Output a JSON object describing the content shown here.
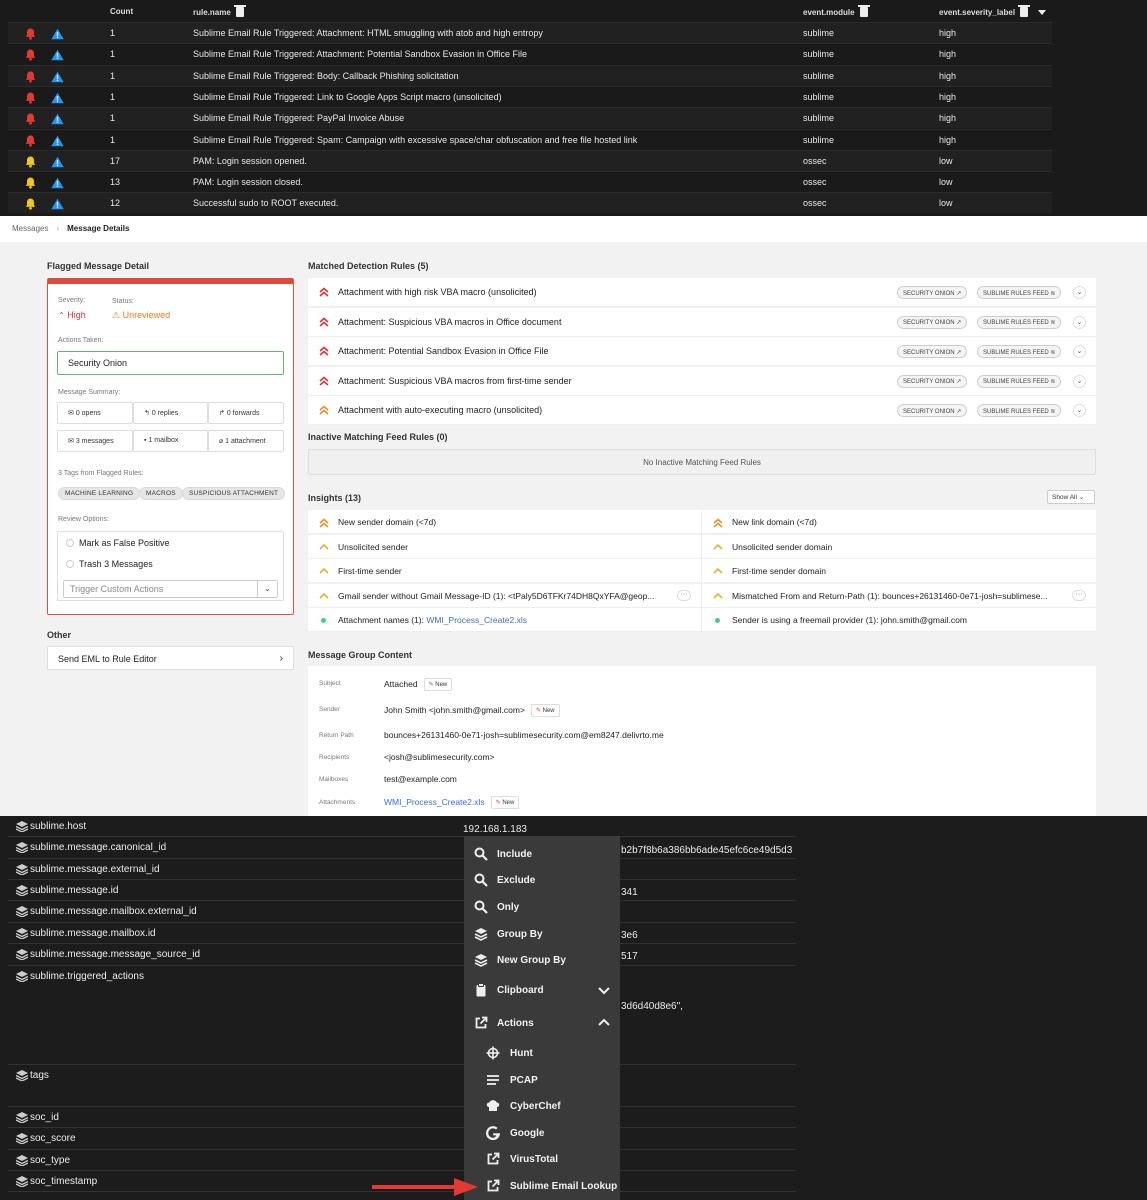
{
  "alerts_table": {
    "columns": {
      "count": "Count",
      "rule_name": "rule.name",
      "event_module": "event.module",
      "severity": "event.severity_label"
    },
    "rows": [
      {
        "level": "high",
        "count": "1",
        "rule": "Sublime Email Rule Triggered: Attachment: HTML smuggling with atob and high entropy",
        "module": "sublime",
        "severity": "high"
      },
      {
        "level": "high",
        "count": "1",
        "rule": "Sublime Email Rule Triggered: Attachment: Potential Sandbox Evasion in Office File",
        "module": "sublime",
        "severity": "high"
      },
      {
        "level": "high",
        "count": "1",
        "rule": "Sublime Email Rule Triggered: Body: Callback Phishing solicitation",
        "module": "sublime",
        "severity": "high"
      },
      {
        "level": "high",
        "count": "1",
        "rule": "Sublime Email Rule Triggered: Link to Google Apps Script macro (unsolicited)",
        "module": "sublime",
        "severity": "high"
      },
      {
        "level": "high",
        "count": "1",
        "rule": "Sublime Email Rule Triggered: PayPal Invoice Abuse",
        "module": "sublime",
        "severity": "high"
      },
      {
        "level": "high",
        "count": "1",
        "rule": "Sublime Email Rule Triggered: Spam: Campaign with excessive space/char obfuscation and free file hosted link",
        "module": "sublime",
        "severity": "high"
      },
      {
        "level": "low",
        "count": "17",
        "rule": "PAM: Login session opened.",
        "module": "ossec",
        "severity": "low"
      },
      {
        "level": "low",
        "count": "13",
        "rule": "PAM: Login session closed.",
        "module": "ossec",
        "severity": "low"
      },
      {
        "level": "low",
        "count": "12",
        "rule": "Successful sudo to ROOT executed.",
        "module": "ossec",
        "severity": "low"
      }
    ]
  },
  "breadcrumb": {
    "parent": "Messages",
    "current": "Message Details"
  },
  "flagged": {
    "title": "Flagged Message Detail",
    "severity_label": "Severity:",
    "severity_value": "High",
    "status_label": "Status:",
    "status_value": "Unreviewed",
    "actions_label": "Actions Taken:",
    "actions_value": "Security Onion",
    "summary_label": "Message Summary:",
    "summary": [
      "0 opens",
      "0 replies",
      "0 forwards",
      "3 messages",
      "1 mailbox",
      "1 attachment"
    ],
    "tags_label": "3 Tags from Flagged Rules:",
    "tags": [
      "MACHINE LEARNING",
      "MACROS",
      "SUSPICIOUS ATTACHMENT"
    ],
    "review_label": "Review Options:",
    "review_options": [
      "Mark as False Positive",
      "Trash 3 Messages"
    ],
    "trigger_placeholder": "Trigger Custom Actions"
  },
  "other": {
    "title": "Other",
    "button": "Send EML to Rule Editor"
  },
  "matched": {
    "title": "Matched Detection Rules (5)",
    "tag1": "SECURITY ONION",
    "tag2": "SUBLIME RULES FEED",
    "rules": [
      {
        "name": "Attachment with high risk VBA macro (unsolicited)",
        "level": "high"
      },
      {
        "name": "Attachment: Suspicious VBA macros in Office document",
        "level": "high"
      },
      {
        "name": "Attachment: Potential Sandbox Evasion in Office File",
        "level": "high"
      },
      {
        "name": "Attachment: Suspicious VBA macros from first-time sender",
        "level": "high"
      },
      {
        "name": "Attachment with auto-executing macro (unsolicited)",
        "level": "medium"
      }
    ]
  },
  "inactive": {
    "title": "Inactive Matching Feed Rules (0)",
    "empty": "No Inactive Matching Feed Rules"
  },
  "insights": {
    "title": "Insights (13)",
    "show_all": "Show All",
    "left": [
      {
        "text": "New sender domain (<7d)",
        "icon": "double-chevron"
      },
      {
        "text": "Unsolicited sender",
        "icon": "chevron"
      },
      {
        "text": "First-time sender",
        "icon": "chevron"
      },
      {
        "text": "Gmail sender without Gmail Message-ID (1): <tPaly5D6TFKr74DH8QxYFA@geop...",
        "icon": "chevron",
        "more": true
      },
      {
        "text": "Attachment names (1): ",
        "link": "WMI_Process_Create2.xls",
        "icon": "dot"
      }
    ],
    "right": [
      {
        "text": "New link domain (<7d)",
        "icon": "double-chevron"
      },
      {
        "text": "Unsolicited sender domain",
        "icon": "chevron"
      },
      {
        "text": "First-time sender domain",
        "icon": "chevron"
      },
      {
        "text": "Mismatched From and Return-Path (1): bounces+26131460-0e71-josh=sublimese...",
        "icon": "chevron",
        "more": true
      },
      {
        "text": "Sender is using a freemail provider (1): john.smith@gmail.com",
        "icon": "dot"
      }
    ]
  },
  "group_content": {
    "title": "Message Group Content",
    "new_label": "New",
    "subject_label": "Subject",
    "subject": "Attached",
    "sender_label": "Sender",
    "sender": "John Smith <john.smith@gmail.com>",
    "return_label": "Return Path",
    "return_path": "bounces+26131460-0e71-josh=sublimesecurity.com@em8247.delivrto.me",
    "recipients_label": "Recipients",
    "recipients": "<josh@sublimesecurity.com>",
    "mailboxes_label": "Mailboxes",
    "mailboxes": "test@example.com",
    "attachments_label": "Attachments",
    "attachments": "WMI_Process_Create2.xls"
  },
  "soc_fields": {
    "names": [
      "sublime.host",
      "sublime.message.canonical_id",
      "sublime.message.external_id",
      "sublime.message.id",
      "sublime.message.mailbox.external_id",
      "sublime.message.mailbox.id",
      "sublime.message.message_source_id",
      "sublime.triggered_actions",
      "tags",
      "soc_id",
      "soc_score",
      "soc_type",
      "soc_timestamp"
    ],
    "host_value": "192.168.1.183",
    "canonical_partial": "b2b7f8b6a386bb6ade45efc6ce49d5d3",
    "id_partial": "341",
    "mailbox_id_partial": "3e6",
    "source_partial": "517",
    "actions_partial": "3d6d40d8e6\","
  },
  "context_menu": {
    "items": [
      "Include",
      "Exclude",
      "Only",
      "Group By",
      "New Group By",
      "Clipboard",
      "Actions"
    ],
    "actions": [
      "Hunt",
      "PCAP",
      "CyberChef",
      "Google",
      "VirusTotal",
      "Sublime Email Lookup"
    ]
  },
  "colors": {
    "high": "#e53935",
    "low": "#f5c518",
    "warn_icon": "#2196f3",
    "flag_border": "#e04a3a",
    "arrow": "#e53935"
  }
}
